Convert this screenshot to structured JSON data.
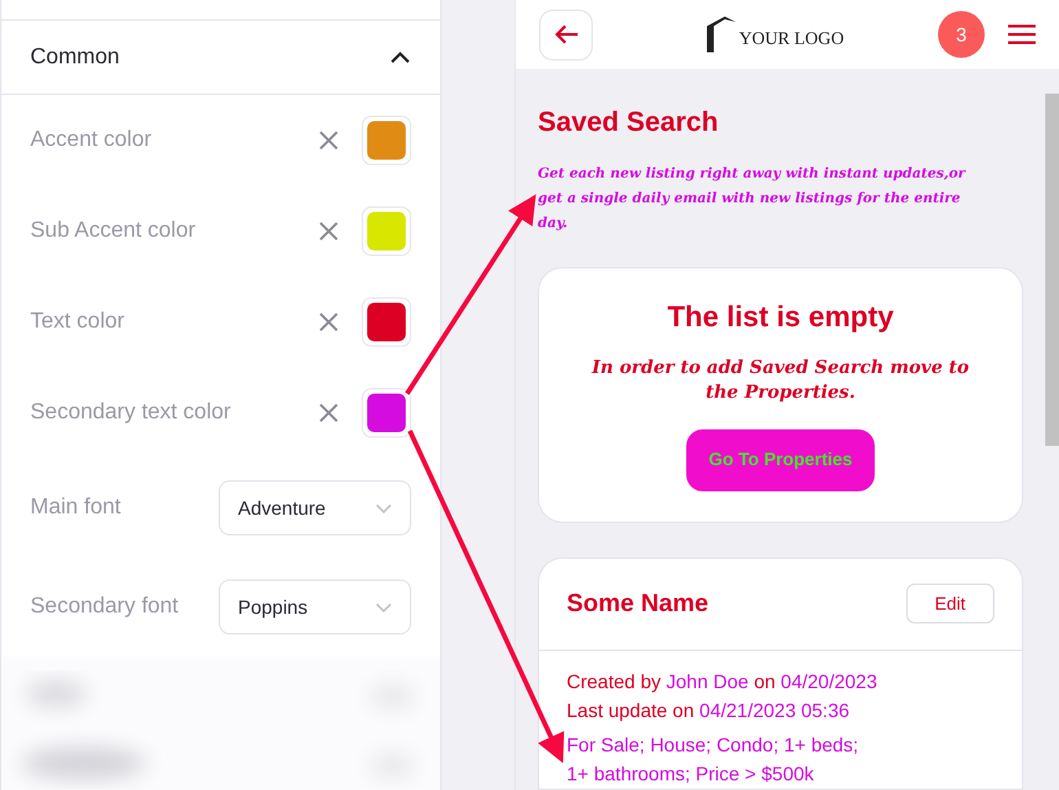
{
  "settings": {
    "section": {
      "title": "Common",
      "expanded": true
    },
    "color_rows": [
      {
        "label": "Accent color",
        "color": "#e08c14"
      },
      {
        "label": "Sub Accent color",
        "color": "#d8e600"
      },
      {
        "label": "Text color",
        "color": "#dc0024"
      },
      {
        "label": "Secondary text color",
        "color": "#d50ce0"
      }
    ],
    "font_rows": [
      {
        "label": "Main font",
        "value": "Adventure"
      },
      {
        "label": "Secondary font",
        "value": "Poppins"
      }
    ]
  },
  "preview": {
    "header": {
      "logo": "YOUR LOGO",
      "badge": "3"
    },
    "title": "Saved Search",
    "description": "Get each new listing right away with instant updates,or get a single daily email with new listings for the entire day.",
    "empty_card": {
      "title": "The list is empty",
      "message": "In order to add Saved Search move to the Properties.",
      "button": "Go To Properties"
    },
    "search_card": {
      "name": "Some Name",
      "edit": "Edit",
      "lines": [
        [
          {
            "kind": "label",
            "text": "Created by"
          },
          {
            "kind": "value",
            "text": "John Doe"
          },
          {
            "kind": "label",
            "text": "on"
          },
          {
            "kind": "value",
            "text": "04/20/2023"
          }
        ],
        [
          {
            "kind": "label",
            "text": "Last update on"
          },
          {
            "kind": "value",
            "text": "04/21/2023 05:36"
          }
        ]
      ],
      "criteria": "For Sale; House; Condo; 1+ beds; 1+ bathrooms; Price > $500k"
    }
  }
}
